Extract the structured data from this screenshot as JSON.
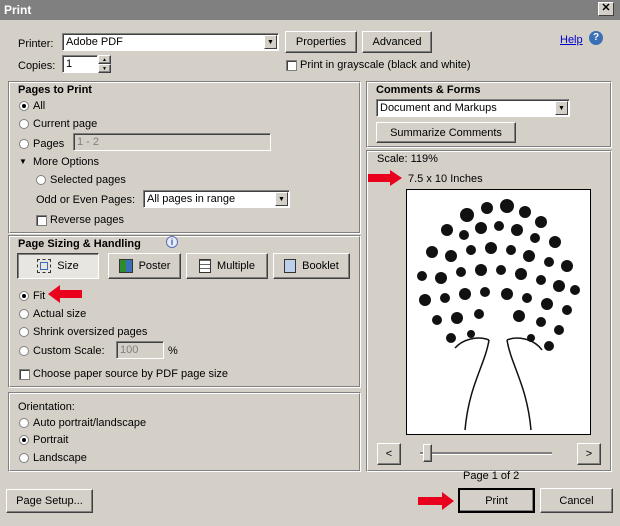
{
  "window": {
    "title": "Print",
    "close_glyph": "✕"
  },
  "printer": {
    "label": "Printer:",
    "value": "Adobe PDF",
    "properties_label": "Properties",
    "advanced_label": "Advanced",
    "help_label": "Help"
  },
  "copies": {
    "label": "Copies:",
    "value": "1"
  },
  "grayscale": {
    "label": "Print in grayscale (black and white)"
  },
  "pages_to_print": {
    "title": "Pages to Print",
    "all_label": "All",
    "current_label": "Current page",
    "pages_label": "Pages",
    "pages_placeholder": "1 - 2",
    "more_options_label": "More Options",
    "selected_pages_label": "Selected pages",
    "odd_even_label": "Odd or Even Pages:",
    "odd_even_value": "All pages in range",
    "reverse_label": "Reverse pages"
  },
  "sizing": {
    "title": "Page Sizing & Handling",
    "size_label": "Size",
    "poster_label": "Poster",
    "multiple_label": "Multiple",
    "booklet_label": "Booklet",
    "fit_label": "Fit",
    "actual_label": "Actual size",
    "shrink_label": "Shrink oversized pages",
    "custom_label": "Custom Scale:",
    "custom_value": "100",
    "percent": "%",
    "paper_source_label": "Choose paper source by PDF page size"
  },
  "orientation": {
    "title": "Orientation:",
    "auto_label": "Auto portrait/landscape",
    "portrait_label": "Portrait",
    "landscape_label": "Landscape"
  },
  "comments": {
    "title": "Comments & Forms",
    "value": "Document and Markups",
    "summarize_label": "Summarize Comments"
  },
  "preview": {
    "scale_label": "Scale: 119%",
    "dims_label": "7.5 x 10 Inches",
    "prev_glyph": "<",
    "next_glyph": ">",
    "page_label": "Page 1 of 2"
  },
  "footer": {
    "page_setup_label": "Page Setup...",
    "print_label": "Print",
    "cancel_label": "Cancel"
  },
  "colors": {
    "annotation_arrow": "#e8001c",
    "dialog_bg": "#d4d0c8",
    "link": "#0000cc"
  },
  "icons": [
    "close-icon",
    "help-icon",
    "info-icon",
    "size-icon",
    "poster-icon",
    "multiple-icon",
    "booklet-icon",
    "triangle-down-icon",
    "red-arrow-annotation"
  ]
}
